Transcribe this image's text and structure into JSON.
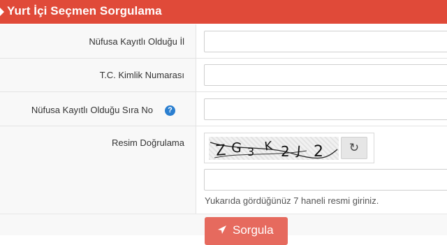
{
  "header": {
    "title": "Yurt İçi Seçmen Sorgulama"
  },
  "form": {
    "fields": [
      {
        "label": "Nüfusa Kayıtlı Olduğu İl",
        "value": ""
      },
      {
        "label": "T.C. Kimlik Numarası",
        "value": ""
      },
      {
        "label": "Nüfusa Kayıtlı Olduğu Sıra No",
        "value": "",
        "help_icon": "?"
      }
    ],
    "captcha": {
      "label": "Resim Doğrulama",
      "image_text": "ZG3K2J2",
      "refresh_icon": "↻",
      "value": "",
      "hint": "Yukarıda gördüğünüz 7 haneli resmi giriniz."
    }
  },
  "actions": {
    "submit_label": "Sorgula"
  },
  "colors": {
    "header_bg": "#e04a39",
    "button_bg": "#e66a5e",
    "help_icon": "#2b7fd0"
  }
}
